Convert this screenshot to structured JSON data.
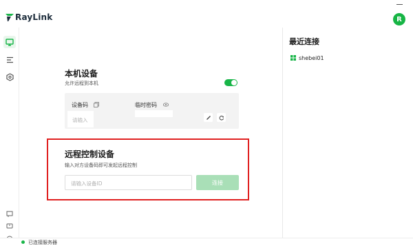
{
  "app": {
    "brand": "RayLink",
    "user_initial": "R"
  },
  "colors": {
    "accent": "#18b548",
    "connect_disabled": "#a9dfb7",
    "highlight_border": "#e02020"
  },
  "sidebar": {
    "items": [
      {
        "icon": "monitor-icon",
        "active": true
      },
      {
        "icon": "list-icon",
        "active": false
      },
      {
        "icon": "hexagon-settings-icon",
        "active": false
      }
    ],
    "bottom_icons": [
      "message-icon",
      "chat-icon",
      "help-icon"
    ]
  },
  "local_device": {
    "title": "本机设备",
    "allow_remote_label": "允许远程到本机",
    "allow_remote_enabled": true,
    "device_code_label": "设备码",
    "temp_password_label": "临时密码",
    "device_code_placeholder": "请输入"
  },
  "remote_control": {
    "title": "远程控制设备",
    "subtitle": "输入对方设备码即可发起远程控制",
    "input_placeholder": "请输入设备ID",
    "connect_label": "连接"
  },
  "recent": {
    "title": "最近连接",
    "items": [
      {
        "name": "shebei01",
        "icon": "windows-icon"
      }
    ]
  },
  "status": {
    "text": "已连接服务器"
  }
}
